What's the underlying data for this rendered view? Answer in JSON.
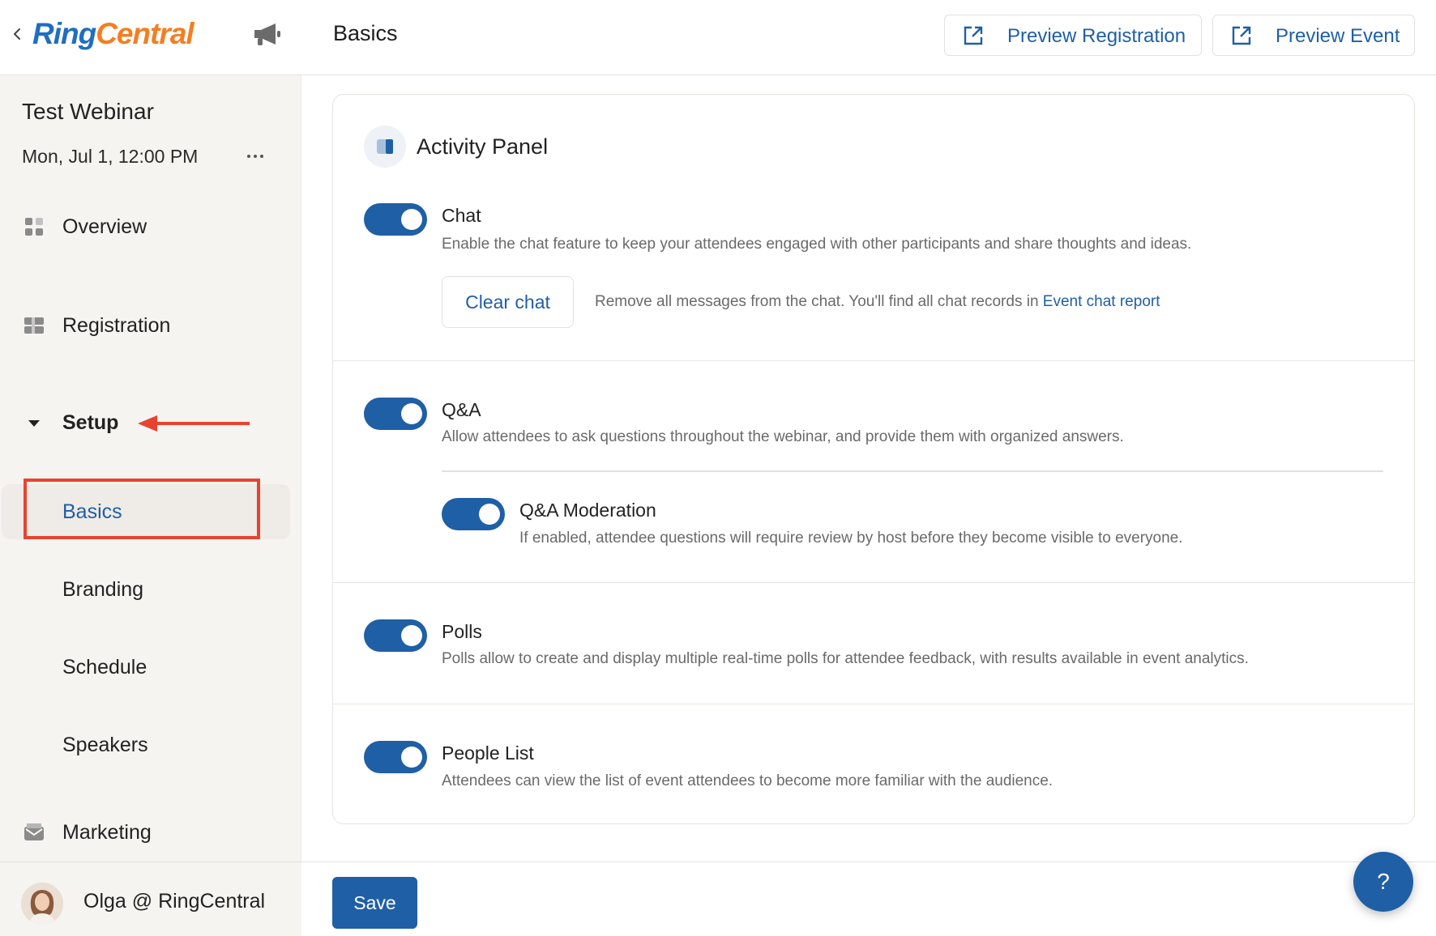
{
  "brand": {
    "logo_part1": "Ring",
    "logo_part2": "Central"
  },
  "event": {
    "title": "Test Webinar",
    "date": "Mon, Jul 1, 12:00 PM"
  },
  "nav": {
    "overview": "Overview",
    "registration": "Registration",
    "setup": "Setup",
    "setup_children": [
      "Basics",
      "Branding",
      "Schedule",
      "Speakers"
    ],
    "marketing": "Marketing"
  },
  "user": {
    "name": "Olga @ RingCentral"
  },
  "header": {
    "title": "Basics",
    "preview_registration": "Preview Registration",
    "preview_event": "Preview Event"
  },
  "panel": {
    "title": "Activity Panel",
    "features": {
      "chat": {
        "title": "Chat",
        "enabled": true,
        "desc": "Enable the chat feature to keep your attendees engaged with other participants and share thoughts and ideas.",
        "clear_label": "Clear chat",
        "clear_desc": "Remove all messages from the chat. You'll find all chat records in",
        "clear_link": "Event chat report"
      },
      "qa": {
        "title": "Q&A",
        "enabled": true,
        "desc": "Allow attendees to ask questions throughout the webinar, and provide them with organized answers."
      },
      "qa_moderation": {
        "title": "Q&A Moderation",
        "enabled": true,
        "desc": "If enabled, attendee questions will require review by host before they become visible to everyone."
      },
      "polls": {
        "title": "Polls",
        "enabled": true,
        "desc": "Polls allow to create and display multiple real-time polls for attendee feedback, with results available in event analytics."
      },
      "people_list": {
        "title": "People List",
        "enabled": true,
        "desc": "Attendees can view the list of event attendees to become more familiar with the audience."
      }
    }
  },
  "footer": {
    "save": "Save",
    "help": "?"
  },
  "colors": {
    "primary": "#1f5fa6",
    "logo_blue": "#1f6ec2",
    "logo_orange": "#f47e20",
    "annotation_red": "#e8432f"
  }
}
